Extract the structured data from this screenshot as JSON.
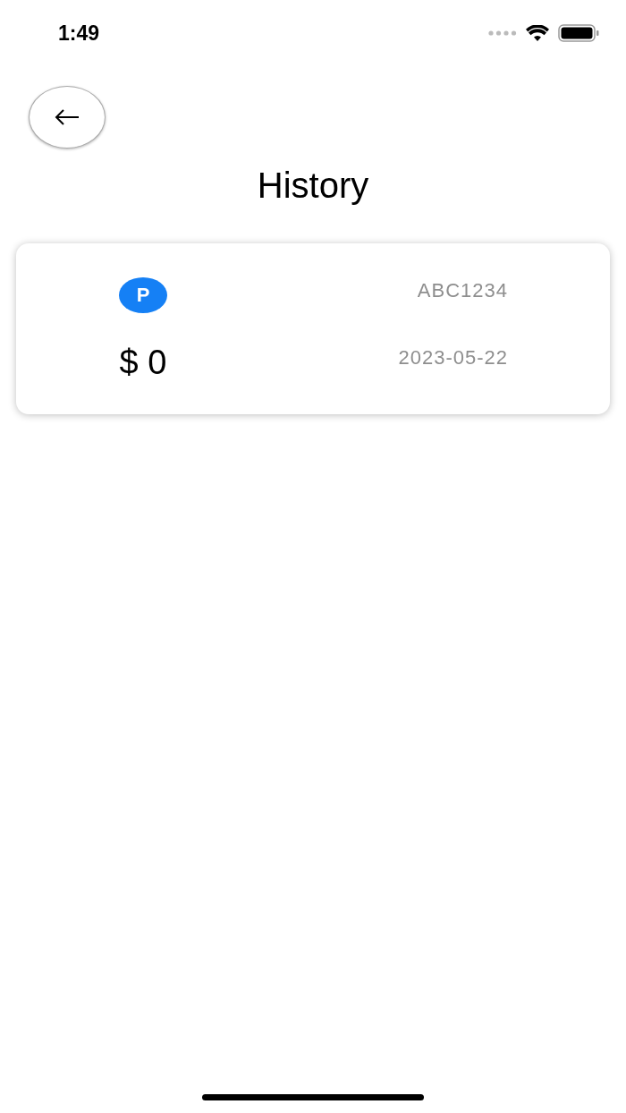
{
  "status_bar": {
    "time": "1:49"
  },
  "header": {
    "title": "History"
  },
  "history": [
    {
      "badge": "P",
      "plate": "ABC1234",
      "amount": "$ 0",
      "date": "2023-05-22"
    }
  ]
}
